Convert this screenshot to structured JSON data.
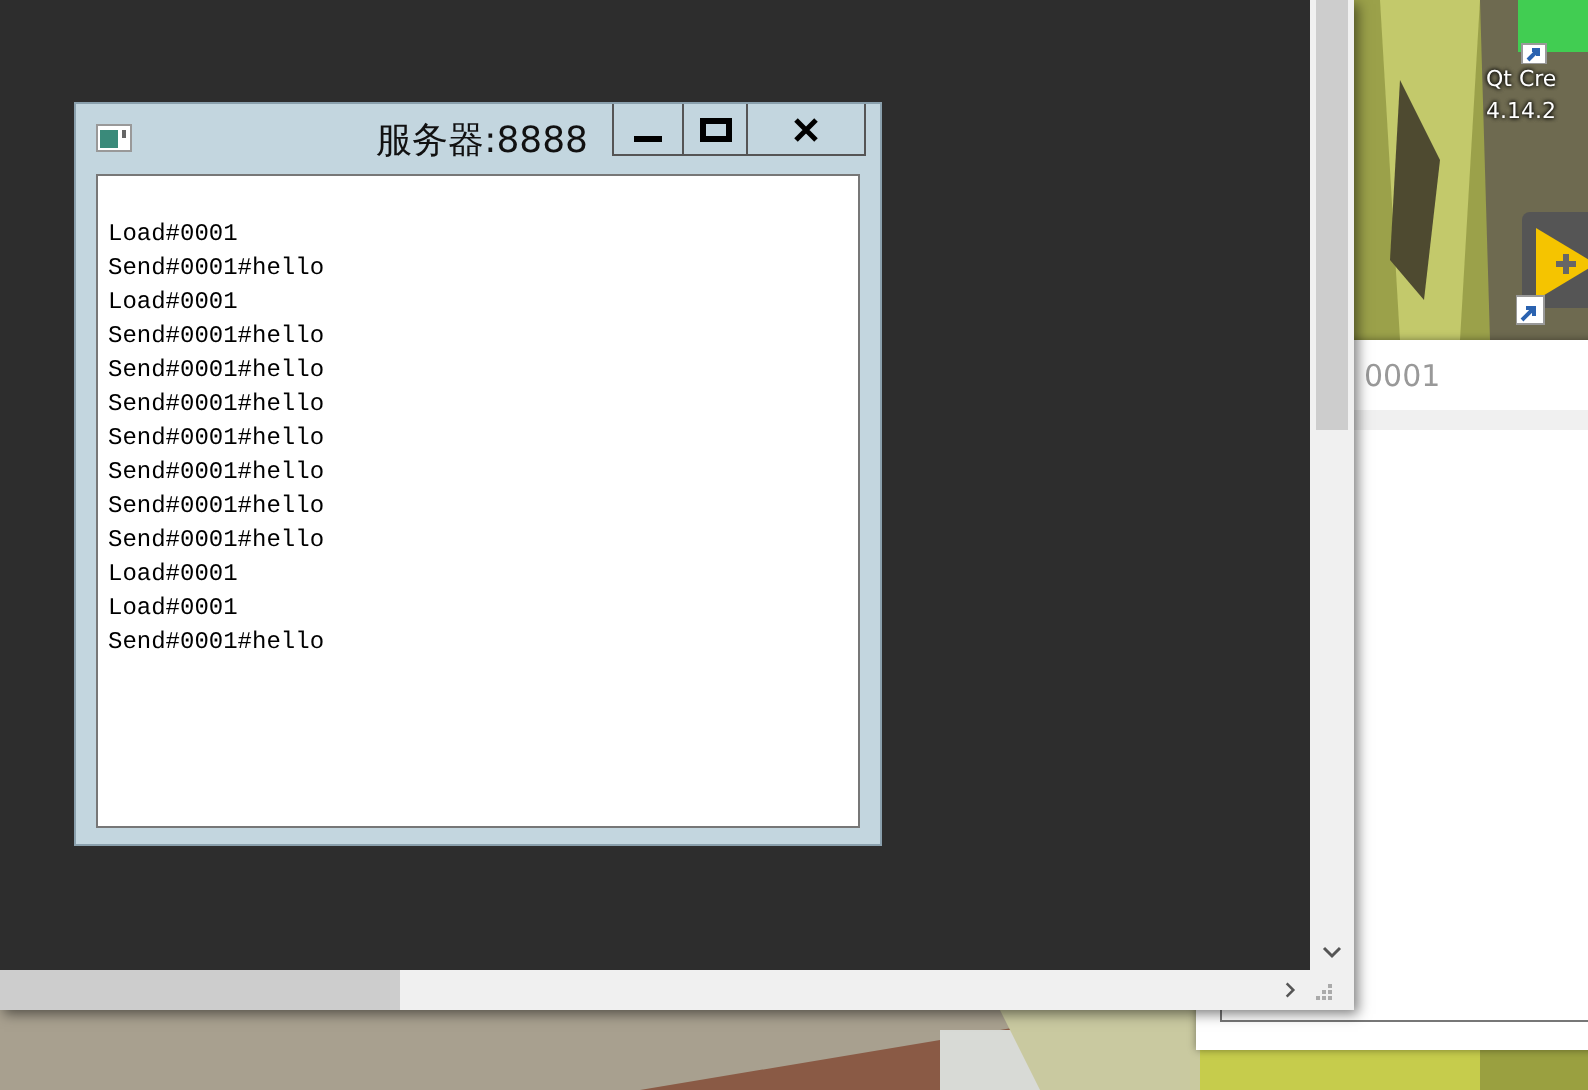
{
  "desktop_icons": [
    {
      "label_lines": [
        "Qt Cre",
        "4.14.2"
      ]
    }
  ],
  "back_window": {
    "text": "0001"
  },
  "server_window": {
    "title": "服务器:8888",
    "log_lines": [
      "Load#0001",
      "Send#0001#hello",
      "Load#0001",
      "Send#0001#hello",
      "Send#0001#hello",
      "Send#0001#hello",
      "Send#0001#hello",
      "Send#0001#hello",
      "Send#0001#hello",
      "Send#0001#hello",
      "Load#0001",
      "Load#0001",
      "Send#0001#hello"
    ]
  }
}
